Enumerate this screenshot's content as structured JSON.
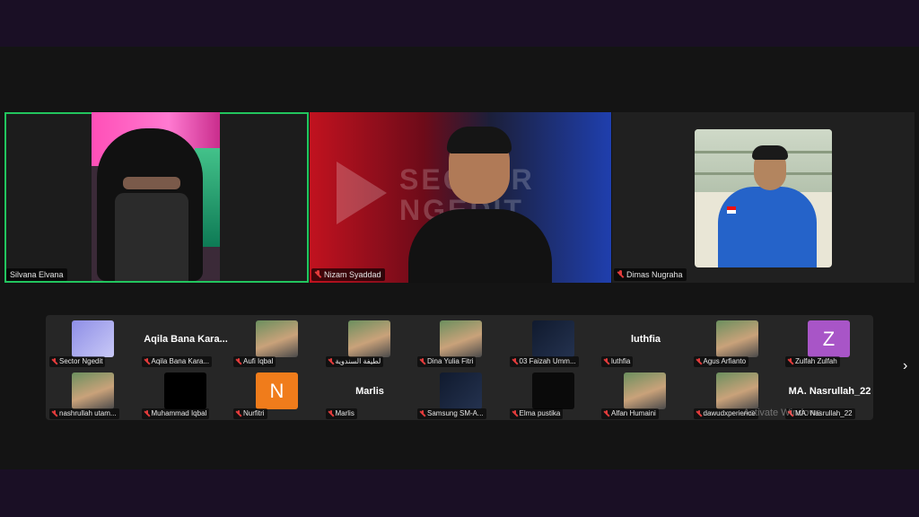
{
  "main_tiles": [
    {
      "name": "Silvana Elvana",
      "active": true
    },
    {
      "name": "Nizam Syaddad",
      "brand_text": "SECTOR NGEDIT"
    },
    {
      "name": "Dimas Nugraha"
    }
  ],
  "gallery": {
    "row1": [
      {
        "name": "Sector Ngedit",
        "thumb": "sector-logo"
      },
      {
        "name": "Aqila Bana Kara...",
        "title": "Aqila Bana Kara..."
      },
      {
        "name": "Aufi Iqbal",
        "thumb": "photo"
      },
      {
        "name": "لطيفة السندوية",
        "thumb": "photo"
      },
      {
        "name": "Dina Yulia Fitri",
        "thumb": "photo"
      },
      {
        "name": "03 Faizah Umm...",
        "thumb": "logo"
      },
      {
        "name": "luthfia",
        "title": "luthfia"
      },
      {
        "name": "Agus Arfianto",
        "thumb": "photo"
      },
      {
        "name": "Zulfah Zulfah",
        "letter": "Z"
      }
    ],
    "row2": [
      {
        "name": "nashrullah utam...",
        "thumb": "photo"
      },
      {
        "name": "Muhammad Iqbal",
        "thumb": "black"
      },
      {
        "name": "Nurfitri",
        "letter": "N"
      },
      {
        "name": "Marlis",
        "title": "Marlis"
      },
      {
        "name": "Samsung SM-A...",
        "thumb": "logo"
      },
      {
        "name": "Elma pustika",
        "thumb": "calligraphy"
      },
      {
        "name": "Alfan Humaini",
        "thumb": "photo"
      },
      {
        "name": "dawudxperience",
        "thumb": "photo"
      },
      {
        "name": "MA. Nasrullah_22",
        "title": "MA. Nasrullah_22"
      }
    ]
  },
  "watermark": "Activate Windows",
  "colors": {
    "active_border": "#22c55e",
    "muted_mic": "#e23b3b",
    "avatar_z": "#a855c7",
    "avatar_n": "#f07c1b"
  },
  "icons": {
    "next_page": "›"
  }
}
